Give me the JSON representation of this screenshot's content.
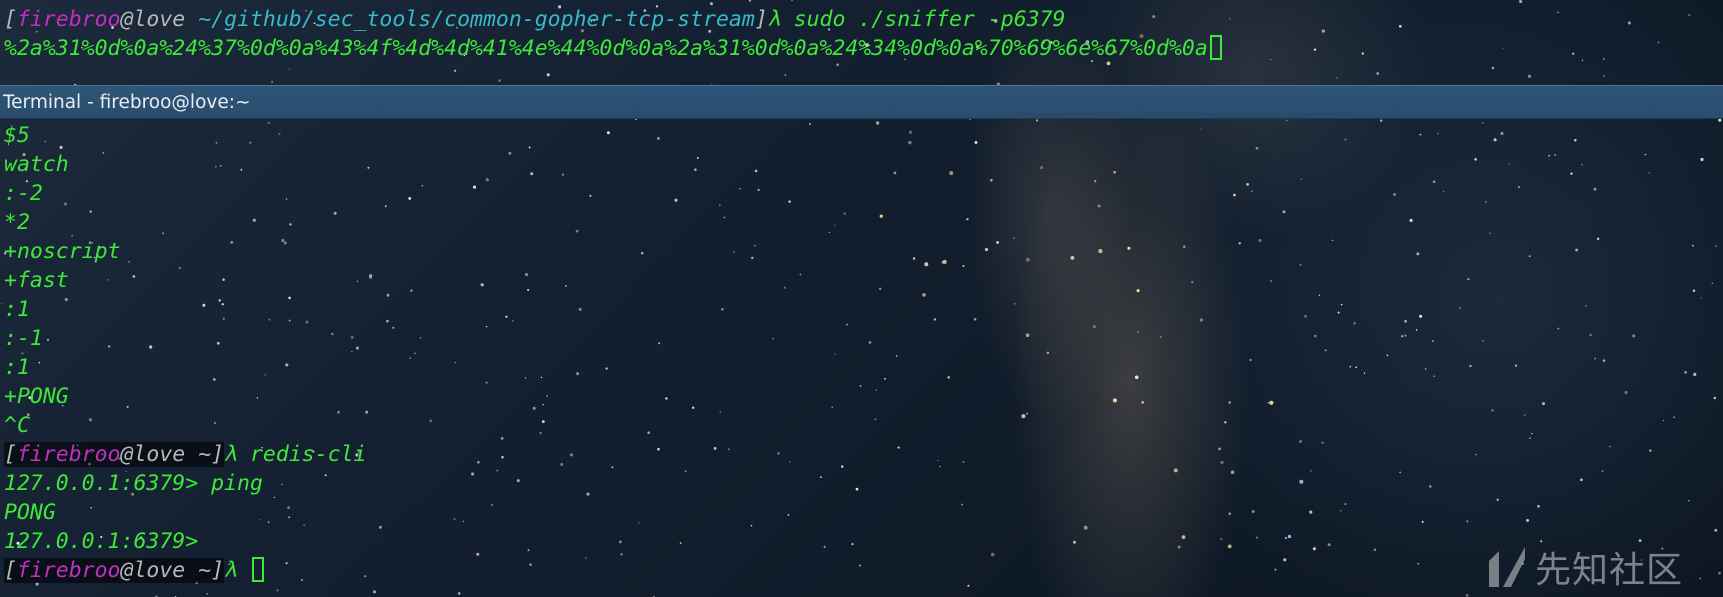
{
  "top_terminal": {
    "prompt": {
      "bracket_open": "[",
      "user": "firebroo",
      "at_host": "@love",
      "path": " ~/github/sec_tools/common-gopher-tcp-stream",
      "bracket_close": "]",
      "lambda": "λ",
      "command": " sudo ./sniffer -p6379"
    },
    "output_line": "%2a%31%0d%0a%24%37%0d%0a%43%4f%4d%4d%41%4e%44%0d%0a%2a%31%0d%0a%24%34%0d%0a%70%69%6e%67%0d%0a"
  },
  "window": {
    "title": "Terminal - firebroo@love:~"
  },
  "main_terminal": {
    "output_lines": [
      "$5",
      "watch",
      ":-2",
      "*2",
      "+noscript",
      "+fast",
      ":1",
      ":-1",
      ":1",
      "+PONG",
      "^C"
    ],
    "prompt1": {
      "bracket_open": "[",
      "user": "firebroo",
      "at_host": "@love",
      "path": " ~",
      "bracket_close": "]",
      "lambda": "λ",
      "command": " redis-cli"
    },
    "redis_lines": [
      "127.0.0.1:6379> ping",
      "PONG",
      "127.0.0.1:6379>"
    ],
    "prompt2": {
      "bracket_open": "[",
      "user": "firebroo",
      "at_host": "@love",
      "path": " ~",
      "bracket_close": "]",
      "lambda": "λ",
      "command": " "
    }
  },
  "watermark": {
    "text": "先知社区",
    "logo_icon": "xianzhi-logo-icon"
  },
  "colors": {
    "terminal_green": "#3ee838",
    "user_magenta": "#c22fc0",
    "path_cyan": "#36b9c8",
    "bracket_gray": "#b8b8b8",
    "titlebar_blue": "#2b4f70"
  }
}
